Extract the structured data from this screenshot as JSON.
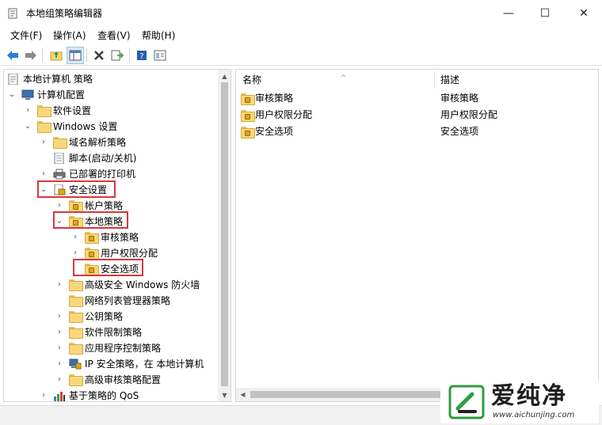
{
  "window": {
    "title": "本地组策略编辑器",
    "minimize_glyph": "—",
    "maximize_glyph": "☐",
    "close_glyph": "✕"
  },
  "menu": [
    {
      "label": "文件(F)"
    },
    {
      "label": "操作(A)"
    },
    {
      "label": "查看(V)"
    },
    {
      "label": "帮助(H)"
    }
  ],
  "toolbar": {
    "icons": [
      "back-arrow-icon",
      "forward-arrow-icon",
      "up-folder-icon",
      "show-hide-tree-icon",
      "delete-icon",
      "export-list-icon",
      "help-icon",
      "properties-icon"
    ]
  },
  "tree": [
    {
      "label": "本地计算机 策略",
      "icon": "policy-document-icon"
    },
    {
      "label": "计算机配置",
      "icon": "computer-icon",
      "chevron": "⌄"
    },
    {
      "label": "软件设置",
      "icon": "folder-icon",
      "chevron": "›"
    },
    {
      "label": "Windows 设置",
      "icon": "folder-icon",
      "chevron": "⌄"
    },
    {
      "label": "域名解析策略",
      "icon": "folder-icon",
      "chevron": "›"
    },
    {
      "label": "脚本(启动/关机)",
      "icon": "script-icon"
    },
    {
      "label": "已部署的打印机",
      "icon": "printer-icon",
      "chevron": "›"
    },
    {
      "label": "安全设置",
      "icon": "security-settings-icon",
      "chevron": "⌄"
    },
    {
      "label": "帐户策略",
      "icon": "locked-folder-icon",
      "chevron": "›"
    },
    {
      "label": "本地策略",
      "icon": "locked-folder-icon",
      "chevron": "⌄"
    },
    {
      "label": "审核策略",
      "icon": "locked-folder-icon",
      "chevron": "›"
    },
    {
      "label": "用户权限分配",
      "icon": "locked-folder-icon",
      "chevron": "›"
    },
    {
      "label": "安全选项",
      "icon": "locked-folder-icon"
    },
    {
      "label": "高级安全 Windows 防火墙",
      "icon": "folder-icon",
      "chevron": "›"
    },
    {
      "label": "网络列表管理器策略",
      "icon": "folder-icon"
    },
    {
      "label": "公钥策略",
      "icon": "folder-icon",
      "chevron": "›"
    },
    {
      "label": "软件限制策略",
      "icon": "folder-icon",
      "chevron": "›"
    },
    {
      "label": "应用程序控制策略",
      "icon": "folder-icon",
      "chevron": "›"
    },
    {
      "label": "IP 安全策略，在 本地计算机",
      "icon": "ip-security-icon",
      "chevron": "›"
    },
    {
      "label": "高级审核策略配置",
      "icon": "folder-icon",
      "chevron": "›"
    },
    {
      "label": "基于策略的 QoS",
      "icon": "qos-chart-icon",
      "chevron": "›"
    }
  ],
  "list": {
    "columns": [
      "名称",
      "描述"
    ],
    "sort_glyph": "^",
    "rows": [
      {
        "name": "审核策略",
        "desc": "审核策略"
      },
      {
        "name": "用户权限分配",
        "desc": "用户权限分配"
      },
      {
        "name": "安全选项",
        "desc": "安全选项"
      }
    ]
  },
  "watermark": {
    "title": "爱纯净",
    "url": "www.aichunjing.com"
  },
  "colors": {
    "highlight": "#d9373d",
    "folder": "#f6d77b"
  }
}
